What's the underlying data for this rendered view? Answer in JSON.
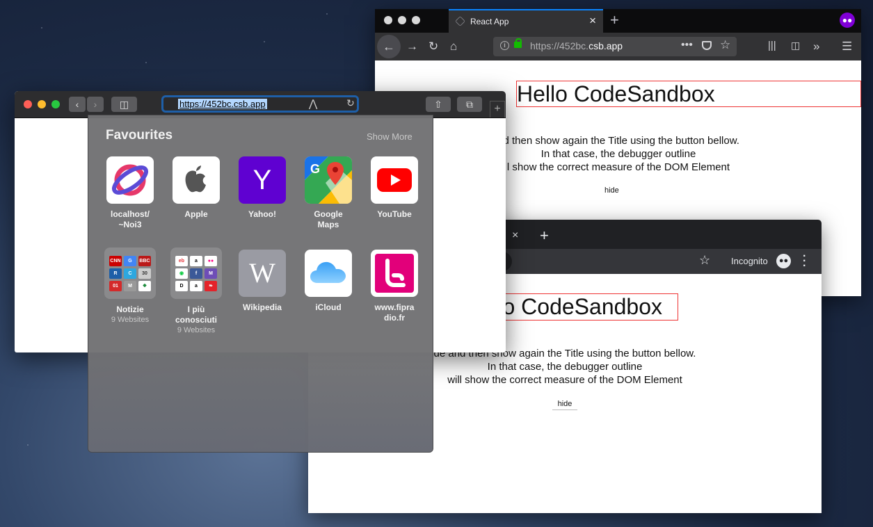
{
  "firefox": {
    "tab_title": "React App",
    "tab_close": "×",
    "new_tab": "+",
    "url_prefix": "https://452bc.",
    "url_domain": "csb.app",
    "page": {
      "heading": "Hello CodeSandbox",
      "paragraph_lines": [
        "nd then show again the Title using the button bellow.",
        "In that case, the debugger outline",
        "l show the correct measure of the DOM Element"
      ],
      "button": "hide"
    }
  },
  "chrome": {
    "tab_close": "×",
    "new_tab": "+",
    "incognito_label": "Incognito",
    "page": {
      "heading": "o CodeSandbox",
      "paragraph_lines": [
        "de and then show again the Title using the button bellow.",
        "In that case, the debugger outline",
        "will show the correct measure of the DOM Element"
      ],
      "button": "hide"
    }
  },
  "safari": {
    "url": "https://452bc.csb.app",
    "new_tab": "+",
    "favourites": {
      "title": "Favourites",
      "show_more": "Show More",
      "items": [
        {
          "label": "localhost/\n~Noi3",
          "icon": "planet-icon"
        },
        {
          "label": "Apple",
          "icon": "apple-icon"
        },
        {
          "label": "Yahoo!",
          "icon": "yahoo-icon",
          "glyph": "Y"
        },
        {
          "label": "Google\nMaps",
          "icon": "google-maps-icon"
        },
        {
          "label": "YouTube",
          "icon": "youtube-icon"
        },
        {
          "label": "Notizie",
          "sub": "9 Websites",
          "icon": "folder-icon"
        },
        {
          "label": "I più\nconosciuti",
          "sub": "9 Websites",
          "icon": "folder-icon"
        },
        {
          "label": "Wikipedia",
          "icon": "wikipedia-icon",
          "glyph": "W"
        },
        {
          "label": "iCloud",
          "icon": "icloud-icon"
        },
        {
          "label": "www.fipra\ndio.fr",
          "icon": "fip-icon"
        }
      ]
    }
  },
  "colors": {
    "firefox_accent": "#0a84ff",
    "debug_outline": "#e33333",
    "safari_url_focus": "#1e5fa8",
    "yahoo": "#5f01d1",
    "youtube": "#ff0000",
    "fip": "#e2007a",
    "incognito_mask": "#8000d7"
  }
}
